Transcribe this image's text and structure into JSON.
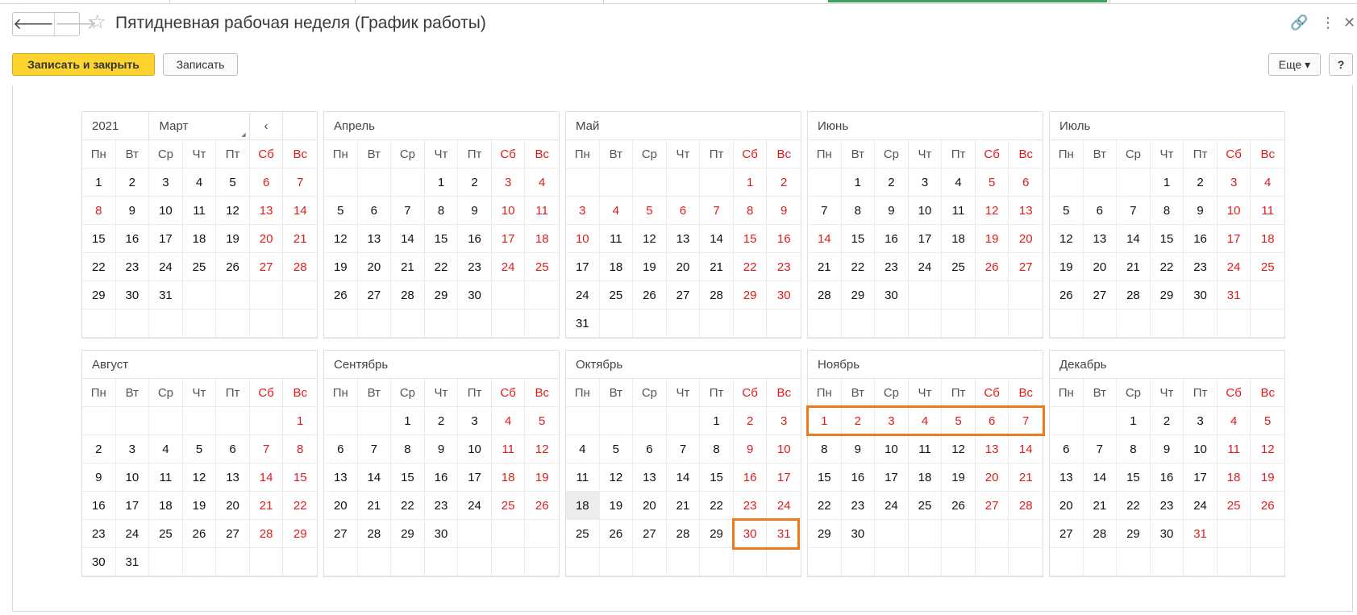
{
  "window": {
    "title": "Пятидневная рабочая неделя (График работы)",
    "nav_back_glyph": "🡐",
    "nav_forward_glyph": "🡒",
    "star_glyph": "☆",
    "link_glyph": "🔗",
    "menu_glyph": "⋮",
    "close_glyph": "✕"
  },
  "toolbar": {
    "save_close_label": "Записать и закрыть",
    "save_label": "Записать",
    "more_label": "Еще ▾",
    "help_label": "?"
  },
  "calendar": {
    "year": "2021",
    "first_month_select": "Март",
    "prev_arrow": "‹",
    "weekdays": [
      "Пн",
      "Вт",
      "Ср",
      "Чт",
      "Пт",
      "Сб",
      "Вс"
    ],
    "highlight_color": "#f07a1a",
    "holiday_color": "#e01b1b",
    "months": [
      {
        "name": "Март",
        "first_weekday": 0,
        "days": 31,
        "red": [
          6,
          7,
          8,
          13,
          14,
          20,
          21,
          27,
          28
        ]
      },
      {
        "name": "Апрель",
        "first_weekday": 3,
        "days": 30,
        "red": [
          3,
          4,
          10,
          11,
          17,
          18,
          24,
          25
        ]
      },
      {
        "name": "Май",
        "first_weekday": 5,
        "days": 31,
        "red": [
          1,
          2,
          3,
          4,
          5,
          6,
          7,
          8,
          9,
          10,
          15,
          16,
          22,
          23,
          29,
          30
        ]
      },
      {
        "name": "Июнь",
        "first_weekday": 1,
        "days": 30,
        "red": [
          5,
          6,
          12,
          13,
          14,
          19,
          20,
          26,
          27
        ]
      },
      {
        "name": "Июль",
        "first_weekday": 3,
        "days": 31,
        "red": [
          3,
          4,
          10,
          11,
          17,
          18,
          24,
          25,
          31
        ]
      },
      {
        "name": "Август",
        "first_weekday": 6,
        "days": 31,
        "red": [
          1,
          7,
          8,
          14,
          15,
          21,
          22,
          28,
          29
        ]
      },
      {
        "name": "Сентябрь",
        "first_weekday": 2,
        "days": 30,
        "red": [
          4,
          5,
          11,
          12,
          18,
          19,
          25,
          26
        ]
      },
      {
        "name": "Октябрь",
        "first_weekday": 4,
        "days": 31,
        "red": [
          2,
          3,
          9,
          10,
          16,
          17,
          23,
          24,
          30,
          31
        ],
        "today": 18
      },
      {
        "name": "Ноябрь",
        "first_weekday": 0,
        "days": 30,
        "red": [
          1,
          2,
          3,
          4,
          5,
          6,
          7,
          13,
          14,
          20,
          21,
          27,
          28
        ]
      },
      {
        "name": "Декабрь",
        "first_weekday": 2,
        "days": 31,
        "red": [
          4,
          5,
          11,
          12,
          18,
          19,
          25,
          26,
          31
        ]
      }
    ]
  }
}
